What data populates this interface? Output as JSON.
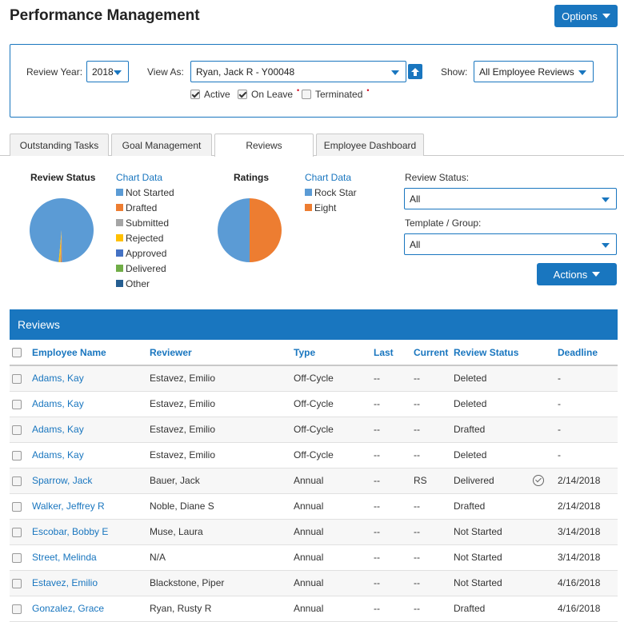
{
  "page": {
    "title": "Performance Management",
    "options_label": "Options"
  },
  "filters": {
    "review_year_label": "Review Year:",
    "review_year_value": "2018",
    "view_as_label": "View As:",
    "view_as_value": "Ryan, Jack R - Y00048",
    "show_label": "Show:",
    "show_value": "All Employee Reviews",
    "checkboxes": [
      {
        "label": "Active",
        "checked": true,
        "required": false
      },
      {
        "label": "On Leave",
        "checked": true,
        "required": true
      },
      {
        "label": "Terminated",
        "checked": false,
        "required": true
      }
    ]
  },
  "tabs": [
    {
      "label": "Outstanding Tasks",
      "active": false
    },
    {
      "label": "Goal Management",
      "active": false
    },
    {
      "label": "Reviews",
      "active": true
    },
    {
      "label": "Employee Dashboard",
      "active": false
    }
  ],
  "review_status_chart": {
    "title": "Review Status",
    "chart_data_link": "Chart Data",
    "legend": [
      {
        "label": "Not Started",
        "color": "#5b9bd5"
      },
      {
        "label": "Drafted",
        "color": "#ed7d31"
      },
      {
        "label": "Submitted",
        "color": "#a5a5a5"
      },
      {
        "label": "Rejected",
        "color": "#ffc000"
      },
      {
        "label": "Approved",
        "color": "#4472c4"
      },
      {
        "label": "Delivered",
        "color": "#70ad47"
      },
      {
        "label": "Other",
        "color": "#255e91"
      }
    ]
  },
  "ratings_chart": {
    "title": "Ratings",
    "chart_data_link": "Chart Data",
    "legend": [
      {
        "label": "Rock Star",
        "color": "#5b9bd5"
      },
      {
        "label": "Eight",
        "color": "#ed7d31"
      }
    ]
  },
  "chart_data": [
    {
      "type": "pie",
      "title": "Review Status",
      "categories": [
        "Not Started",
        "Drafted",
        "Submitted",
        "Rejected",
        "Approved",
        "Delivered",
        "Other"
      ],
      "values": [
        0.985,
        0.005,
        0.003,
        0.007,
        0,
        0,
        0
      ]
    },
    {
      "type": "pie",
      "title": "Ratings",
      "categories": [
        "Rock Star",
        "Eight"
      ],
      "values": [
        0.5,
        0.5
      ]
    }
  ],
  "side_filters": {
    "review_status_label": "Review Status:",
    "review_status_value": "All",
    "template_label": "Template / Group:",
    "template_value": "All",
    "actions_label": "Actions"
  },
  "reviews": {
    "title": "Reviews",
    "columns": [
      "Employee Name",
      "Reviewer",
      "Type",
      "Last",
      "Current",
      "Review Status",
      "Deadline"
    ],
    "rows": [
      {
        "employee": "Adams, Kay",
        "reviewer": "Estavez, Emilio",
        "type": "Off-Cycle",
        "last": "--",
        "current": "--",
        "status": "Deleted",
        "icon": false,
        "deadline": "-"
      },
      {
        "employee": "Adams, Kay",
        "reviewer": "Estavez, Emilio",
        "type": "Off-Cycle",
        "last": "--",
        "current": "--",
        "status": "Deleted",
        "icon": false,
        "deadline": "-"
      },
      {
        "employee": "Adams, Kay",
        "reviewer": "Estavez, Emilio",
        "type": "Off-Cycle",
        "last": "--",
        "current": "--",
        "status": "Drafted",
        "icon": false,
        "deadline": "-"
      },
      {
        "employee": "Adams, Kay",
        "reviewer": "Estavez, Emilio",
        "type": "Off-Cycle",
        "last": "--",
        "current": "--",
        "status": "Deleted",
        "icon": false,
        "deadline": "-"
      },
      {
        "employee": "Sparrow, Jack",
        "reviewer": "Bauer, Jack",
        "type": "Annual",
        "last": "--",
        "current": "RS",
        "status": "Delivered",
        "icon": true,
        "deadline": "2/14/2018"
      },
      {
        "employee": "Walker, Jeffrey R",
        "reviewer": "Noble, Diane S",
        "type": "Annual",
        "last": "--",
        "current": "--",
        "status": "Drafted",
        "icon": false,
        "deadline": "2/14/2018"
      },
      {
        "employee": "Escobar, Bobby E",
        "reviewer": "Muse, Laura",
        "type": "Annual",
        "last": "--",
        "current": "--",
        "status": "Not Started",
        "icon": false,
        "deadline": "3/14/2018"
      },
      {
        "employee": "Street, Melinda",
        "reviewer": "N/A",
        "type": "Annual",
        "last": "--",
        "current": "--",
        "status": "Not Started",
        "icon": false,
        "deadline": "3/14/2018"
      },
      {
        "employee": "Estavez, Emilio",
        "reviewer": "Blackstone, Piper",
        "type": "Annual",
        "last": "--",
        "current": "--",
        "status": "Not Started",
        "icon": false,
        "deadline": "4/16/2018"
      },
      {
        "employee": "Gonzalez, Grace",
        "reviewer": "Ryan, Rusty R",
        "type": "Annual",
        "last": "--",
        "current": "--",
        "status": "Drafted",
        "icon": false,
        "deadline": "4/16/2018"
      }
    ]
  }
}
